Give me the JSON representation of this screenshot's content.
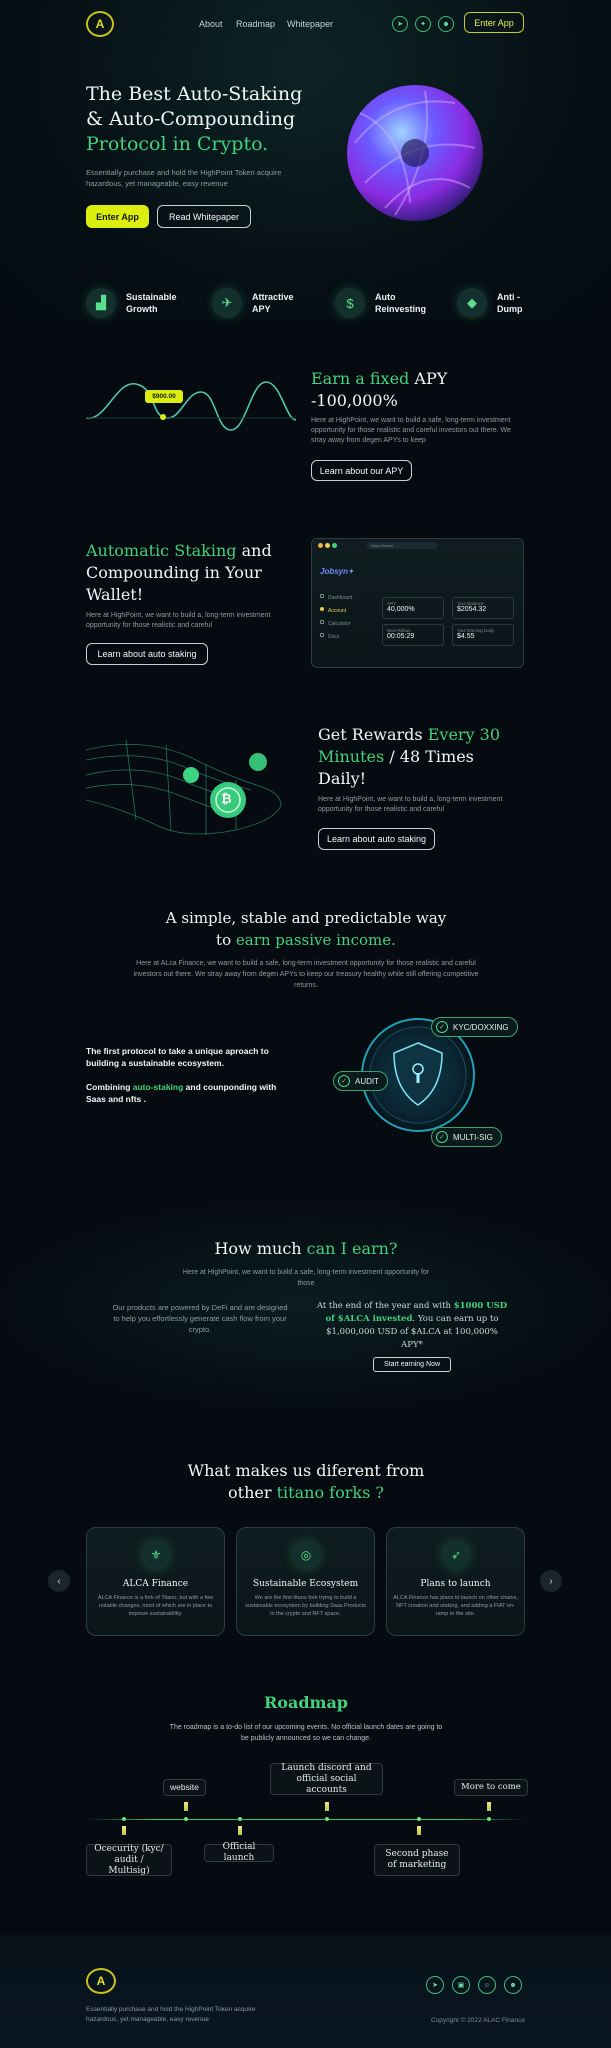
{
  "nav": {
    "about": "About",
    "roadmap": "Roadmap",
    "whitepaper": "Whitepaper",
    "enter_app": "Enter App",
    "logo_letter": "A",
    "social": [
      "telegram-icon",
      "twitter-icon",
      "discord-icon"
    ]
  },
  "hero": {
    "title_line1": "The Best Auto-Staking",
    "title_line2": "& Auto-Compounding",
    "title_line3": "Protocol in Crypto.",
    "desc": "Essentially purchase and hold the HighPoint Token acquire hazardous, yet manageable, easy revenue",
    "btn_enter": "Enter App",
    "btn_whitepaper": "Read Whitepaper"
  },
  "features": [
    {
      "icon": "chart-icon",
      "line1": "Sustainable",
      "line2": "Growth"
    },
    {
      "icon": "runner-icon",
      "line1": "Attractive",
      "line2": "APY"
    },
    {
      "icon": "dollar-icon",
      "line1": "Auto",
      "line2": "Reinvesting"
    },
    {
      "icon": "shield-icon",
      "line1": "Anti -",
      "line2": "Dump"
    }
  ],
  "apy": {
    "title_green": "Earn a fixed",
    "title_rest": "APY",
    "title_line2": "-100,000%",
    "desc": "Here at HighPoint, we want to build a safe, long-term investment opportunity for those realistic and careful investors out there. We stray away from degen APYs to keep",
    "btn": "Learn about our APY",
    "price_tag": "$900.00"
  },
  "staking": {
    "title_green": "Automatic Staking",
    "title_rest": "and",
    "title_line2": "Compounding in Your",
    "title_line3": "Wallet!",
    "desc": "Here at HighPoint, we want to build a, long-term investment opportunity for those realistic and careful",
    "btn": "Learn about auto staking",
    "mock": {
      "url": "https://lorem",
      "logo": "Jobsyn✦",
      "menu": [
        "Dashboard",
        "Account",
        "Calculator",
        "Docs"
      ],
      "stats": [
        {
          "label": "APY",
          "value": "40,000%"
        },
        {
          "label": "Your Balance",
          "value": "$2054.32"
        },
        {
          "label": "Next Rebus",
          "value": "00:05:29"
        },
        {
          "label": "Your Earning Daily",
          "value": "$4.55"
        }
      ]
    }
  },
  "rewards": {
    "title_white": "Get Rewards",
    "title_green1": "Every 30",
    "title_green2": "Minutes",
    "title_rest": "/ 48 Times",
    "title_line3": "Daily!",
    "desc": "Here at HighPoint, we want to build a, long-term investment opportunity for those realistic and careful",
    "btn": "Learn about auto staking",
    "coin_symbol": "₿"
  },
  "passive": {
    "title_line1": "A simple, stable and predictable way",
    "title_to": "to",
    "title_green": "earn passive income.",
    "desc": "Here at ALca Finance, we want to build a safe, long-term investment opportunity for those realistic and careful investors out there. We stray away from degen APYs to keep our treasury healthy while still offering competitive returns."
  },
  "security": {
    "line1": "The first protocol to take a unique aproach to building a sustainable ecosystem.",
    "line2_pre": "Combining",
    "line2_green": "auto-staking",
    "line2_post": "and counponding with Saas and nfts .",
    "labels": [
      "KYC/DOXXING",
      "AUDIT",
      "MULTI-SIG"
    ]
  },
  "earn": {
    "title_white": "How much",
    "title_green": "can I earn?",
    "subtitle": "Here at HighPoint, we want to build a safe, long-term investment opportunity for those",
    "left": "Our products are powered by DeFi and are designed to help you effortlessly generate cash flow from your crypto.",
    "right_pre": "At the end of the year and with",
    "right_green": "$1000 USD of $ALCA invested",
    "right_post": ". You can earn up to $1,000,000 USD of $ALCA at 100,000% APY*",
    "btn": "Start earning Now"
  },
  "diff": {
    "title_line1": "What makes us diferent from",
    "title_other": "other",
    "title_green": "titano forks ?",
    "cards": [
      {
        "icon": "eagle-icon",
        "title": "ALCA Finance",
        "desc": "ALCA Finance is a fork of Titano, but with a few notable changes, most of which are in place to improve sustainability."
      },
      {
        "icon": "target-icon",
        "title": "Sustainable Ecosystem",
        "desc": "We are the first titano fork trying to build a sustainable ecosystem by building Saas Products in the crypto and NFT space."
      },
      {
        "icon": "rocket-icon",
        "title": "Plans to launch",
        "desc": "ALCA Finance has plans to launch on other chains, NFT creation and staking, and adding a FIAT on-ramp to the site."
      }
    ]
  },
  "roadmap": {
    "title": "Roadmap",
    "desc": "The roadmap is a to-do list of our upcoming events. No official launch dates are going to be publicly announced so we can change.",
    "top": [
      "website",
      "Launch discord and official social accounts",
      "More to come"
    ],
    "bottom": [
      "Ocecurity (kyc/ audit / Multisig)",
      "Official launch",
      "Second phase of marketing"
    ]
  },
  "footer": {
    "desc": "Essentially purchase and hold the HighPoint Token acquire hazardous, yet manageable, easy revenue",
    "copyright": "Copyright © 2022 ALAC Finance",
    "social": [
      "telegram-icon",
      "medium-icon",
      "reddit-icon",
      "discord-icon"
    ]
  }
}
